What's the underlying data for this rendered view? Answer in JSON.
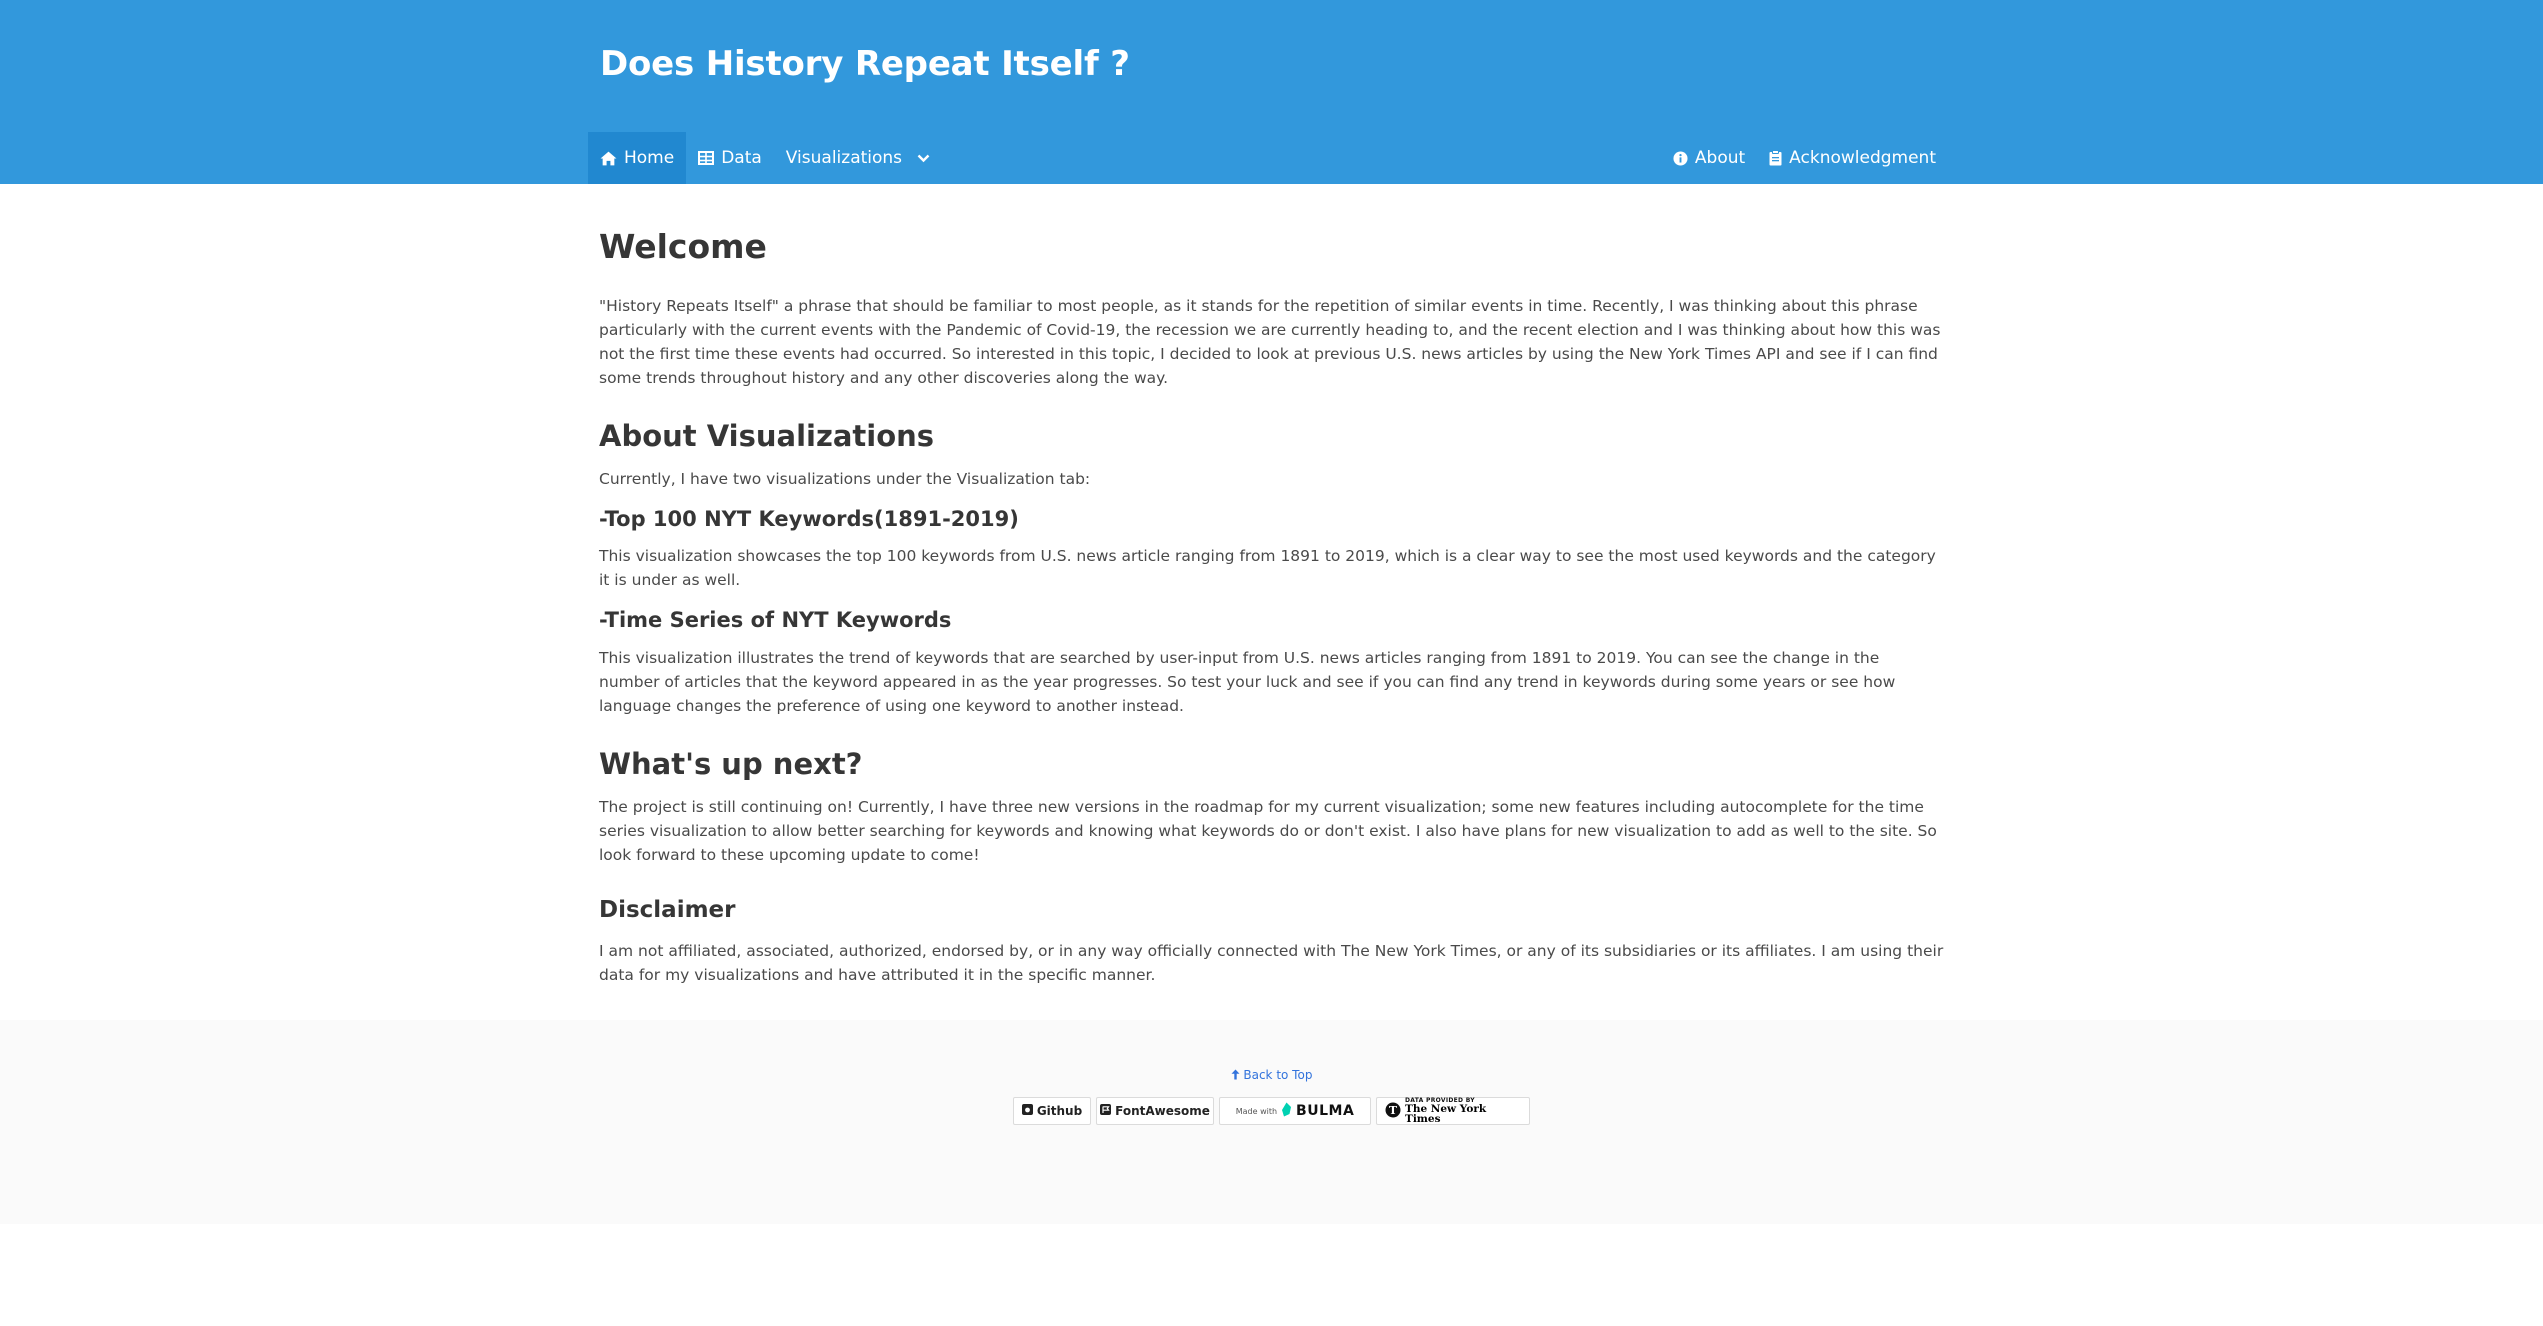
{
  "site": {
    "title": "Does History Repeat Itself ?"
  },
  "nav": {
    "left": [
      {
        "label": "Home",
        "icon": "home-icon",
        "active": true
      },
      {
        "label": "Data",
        "icon": "table-icon"
      },
      {
        "label": "Visualizations",
        "icon": "chevron-down-icon"
      }
    ],
    "right": [
      {
        "label": "About",
        "icon": "info-circle-icon"
      },
      {
        "label": "Acknowledgment",
        "icon": "clipboard-icon"
      }
    ]
  },
  "content": {
    "welcome_heading": "Welcome",
    "welcome_text": "\"History Repeats Itself\" a phrase that should be familiar to most people, as it stands for the repetition of similar events in time. Recently, I was thinking about this phrase particularly with the current events with the Pandemic of Covid-19, the recession we are currently heading to, and the recent election and I was thinking about how this was not the first time these events had occurred. So interested in this topic, I decided to look at previous U.S. news articles by using the New York Times API and see if I can find some trends throughout history and any other discoveries along the way.",
    "about_heading": "About Visualizations",
    "about_intro": "Currently, I have two visualizations under the Visualization tab:",
    "viz1_title": "-Top 100 NYT Keywords(1891-2019)",
    "viz1_text": "This visualization showcases the top 100 keywords from U.S. news article ranging from 1891 to 2019, which is a clear way to see the most used keywords and the category it is under as well.",
    "viz2_title": "-Time Series of NYT Keywords",
    "viz2_text": "This visualization illustrates the trend of keywords that are searched by user-input from U.S. news articles ranging from 1891 to 2019. You can see the change in the number of articles that the keyword appeared in as the year progresses. So test your luck and see if you can find any trend in keywords during some years or see how language changes the preference of using one keyword to another instead.",
    "next_heading": "What's up next?",
    "next_text": "The project is still continuing on! Currently, I have three new versions in the roadmap for my current visualization; some new features including autocomplete for the time series visualization to allow better searching for keywords and knowing what keywords do or don't exist. I also have plans for new visualization to add as well to the site. So look forward to these upcoming update to come!",
    "disclaimer_heading": "Disclaimer",
    "disclaimer_text": "I am not affiliated, associated, authorized, endorsed by, or in any way officially connected with The New York Times, or any of its subsidiaries or its affiliates. I am using their data for my visualizations and have attributed it in the specific manner."
  },
  "footer": {
    "back_to_top": "Back to Top",
    "badges": {
      "github": "Github",
      "fontawesome": "FontAwesome",
      "made_with": "Made with",
      "bulma": "BULMA",
      "nyt_line1": "DATA PROVIDED BY",
      "nyt_line2": "The New York Times"
    }
  },
  "colors": {
    "hero": "#3298dc",
    "nav_active": "#2188d0",
    "link": "#3273dc",
    "bulma_logo": "#00d1b2",
    "footer_bg": "#fafafa"
  }
}
